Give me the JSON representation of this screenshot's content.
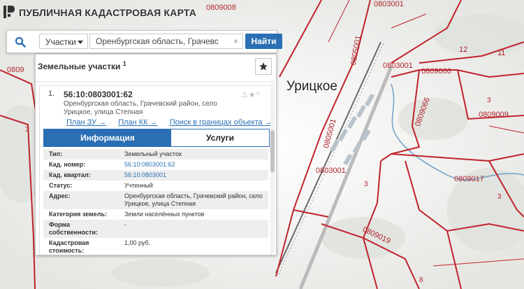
{
  "header": {
    "title": "ПУБЛИЧНАЯ КАДАСТРОВАЯ КАРТА"
  },
  "search": {
    "type_label": "Участки",
    "query_value": "Оренбургская область, Грачевс",
    "clear_label": "×",
    "find_label": "Найти"
  },
  "panel": {
    "title": "Земельные участки",
    "count": "1",
    "result": {
      "index": "1.",
      "number": "56:10:0803001:62",
      "address": "Оренбургская область, Грачевский район, село Урицкое, улица Степная",
      "links": [
        "План ЗУ →",
        "План КК →",
        "Поиск в границах объекта →"
      ]
    },
    "tabs": [
      "Информация",
      "Услуги"
    ],
    "info": [
      {
        "key": "Тип:",
        "value": "Земельный участок"
      },
      {
        "key": "Кад. номер:",
        "value": "56:10:0803001:62"
      },
      {
        "key": "Кад. квартал:",
        "value": "56:10:0803001"
      },
      {
        "key": "Статус:",
        "value": "Учтенный"
      },
      {
        "key": "Адрес:",
        "value": "Оренбургская область, Грачевский район, село Урицкое, улица Степная"
      },
      {
        "key": "Категория земель:",
        "value": "Земли населённых пунктов"
      },
      {
        "key": "Форма собственности:",
        "value": "-"
      },
      {
        "key": "Кадастровая стоимость:",
        "value": "1,00 руб."
      }
    ]
  },
  "map": {
    "village": "Урицкое",
    "labels": [
      "0809008",
      "0803001",
      "0805001",
      "0809066",
      "0809009",
      "0809017",
      "0809019",
      "12",
      "11",
      "3",
      "3",
      "3",
      "3",
      "8",
      "0809",
      "0805001",
      "0803001",
      "0809066"
    ]
  },
  "colors": {
    "accent": "#2a6fb4",
    "boundary": "#c0232c"
  }
}
